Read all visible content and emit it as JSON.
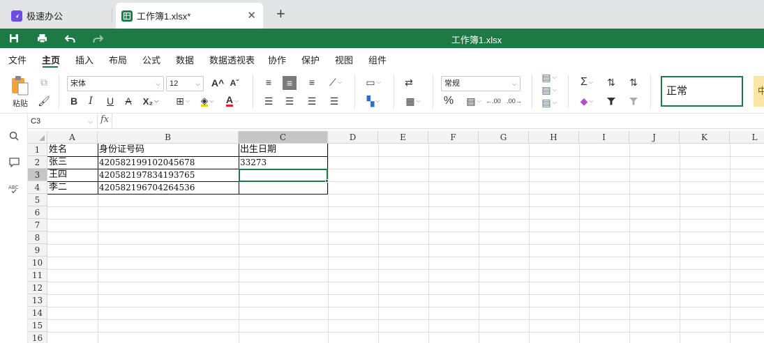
{
  "tabs": [
    {
      "label": "极速办公"
    },
    {
      "label": "工作簿1.xlsx*",
      "close": "✕"
    }
  ],
  "new_tab": "+",
  "title": "工作簿1.xlsx",
  "menu": [
    "文件",
    "主页",
    "插入",
    "布局",
    "公式",
    "数据",
    "数据透视表",
    "协作",
    "保护",
    "视图",
    "组件"
  ],
  "ribbon": {
    "paste_label": "粘贴",
    "font_name": "宋体",
    "font_size": "12",
    "bold": "B",
    "italic": "I",
    "underline": "U",
    "strike": "A",
    "subscript": "X₂",
    "grow_font": "A^",
    "shrink_font": "Aˇ",
    "number_format": "常规",
    "percent": "%",
    "inc_decimal": "←.00",
    "dec_decimal": ".00→",
    "sum": "Σ",
    "style_normal": "正常",
    "style_mid": "中"
  },
  "namebox": "C3",
  "fx": "fx",
  "columns": [
    "A",
    "B",
    "C",
    "D",
    "E",
    "F",
    "G",
    "H",
    "I",
    "J",
    "K",
    "L"
  ],
  "rows": [
    "1",
    "2",
    "3",
    "4",
    "5",
    "6",
    "7",
    "8",
    "9",
    "10",
    "11",
    "12",
    "13",
    "14",
    "15",
    "16"
  ],
  "cells": {
    "A1": "姓名",
    "B1": "身份证号码",
    "C1": "出生日期",
    "A2": "张三",
    "B2": "420582199102045678",
    "C2": "33273",
    "A3": "王四",
    "B3": "420582197834193765",
    "A4": "李二",
    "B4": "420582196704264536"
  },
  "selected_cell": "C3",
  "colors": {
    "accent": "#1d7a45",
    "header_sel": "#c6c6c6"
  }
}
